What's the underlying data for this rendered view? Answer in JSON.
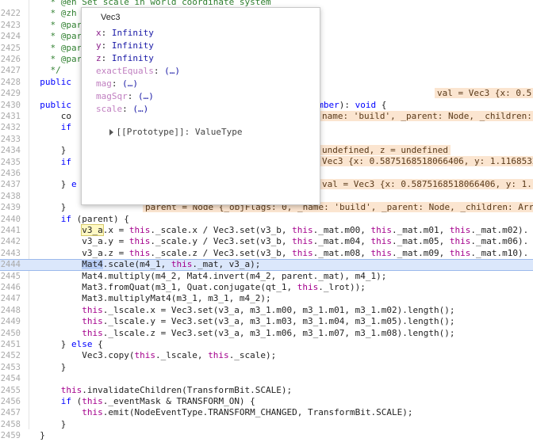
{
  "lines": [
    {
      "n": "",
      "html": "    <span class=\"cm\">* @en Set scale in world coordinate system</span>"
    },
    {
      "n": "2422",
      "html": "    <span class=\"cm\">* @zh</span>"
    },
    {
      "n": "2423",
      "html": "    <span class=\"cm\">* @par</span>"
    },
    {
      "n": "2424",
      "html": "    <span class=\"cm\">* @par</span>"
    },
    {
      "n": "2425",
      "html": "    <span class=\"cm\">* @par</span>"
    },
    {
      "n": "2426",
      "html": "    <span class=\"cm\">* @par</span>"
    },
    {
      "n": "2427",
      "html": "    <span class=\"cm\">*/</span>"
    },
    {
      "n": "2428",
      "html": "  <span class=\"kw\">public</span>                                       ): <span class=\"kw\">void</span>;"
    },
    {
      "n": "2429",
      "html": ""
    },
    {
      "n": "2430",
      "html": "  <span class=\"kw\">public</span>                                       , z?: <span class=\"kw\">number</span>): <span class=\"kw\">void</span> {"
    },
    {
      "n": "2431",
      "html": "      co"
    },
    {
      "n": "2432",
      "html": "      <span class=\"kw\">if</span>"
    },
    {
      "n": "2433",
      "html": ""
    },
    {
      "n": "2434",
      "html": "      }"
    },
    {
      "n": "2435",
      "html": "      <span class=\"kw\">if</span>"
    },
    {
      "n": "2436",
      "html": ""
    },
    {
      "n": "2437",
      "html": "      } <span class=\"kw\">e</span>"
    },
    {
      "n": "2438",
      "html": ""
    },
    {
      "n": "2439",
      "html": "      }"
    },
    {
      "n": "2440",
      "html": "      <span class=\"kw\">if</span> (parent) {"
    },
    {
      "n": "2441",
      "html": "          <span class=\"hl\">v3_a</span>.x = <span class=\"th\">this</span>._scale.x / Vec3.set(v3_b, <span class=\"th\">this</span>._mat.m00, <span class=\"th\">this</span>._mat.m01, <span class=\"th\">this</span>._mat.m02)."
    },
    {
      "n": "2442",
      "html": "          v3_a.y = <span class=\"th\">this</span>._scale.y / Vec3.set(v3_b, <span class=\"th\">this</span>._mat.m04, <span class=\"th\">this</span>._mat.m05, <span class=\"th\">this</span>._mat.m06)."
    },
    {
      "n": "2443",
      "html": "          v3_a.z = <span class=\"th\">this</span>._scale.z / Vec3.set(v3_b, <span class=\"th\">this</span>._mat.m08, <span class=\"th\">this</span>._mat.m09, <span class=\"th\">this</span>._mat.m10)."
    },
    {
      "n": "2444",
      "html": "          <span class=\"sel\">Mat4</span>.scale(m4_1, <span class=\"th\">this</span>._mat, v3_a);",
      "current": true
    },
    {
      "n": "2445",
      "html": "          Mat4.multiply(m4_2, Mat4.invert(m4_2, parent._mat), m4_1);"
    },
    {
      "n": "2446",
      "html": "          Mat3.fromQuat(m3_1, Quat.conjugate(qt_1, <span class=\"th\">this</span>._lrot));"
    },
    {
      "n": "2447",
      "html": "          Mat3.multiplyMat4(m3_1, m3_1, m4_2);"
    },
    {
      "n": "2448",
      "html": "          <span class=\"th\">this</span>._lscale.x = Vec3.set(v3_a, m3_1.m00, m3_1.m01, m3_1.m02).length();"
    },
    {
      "n": "2449",
      "html": "          <span class=\"th\">this</span>._lscale.y = Vec3.set(v3_a, m3_1.m03, m3_1.m04, m3_1.m05).length();"
    },
    {
      "n": "2450",
      "html": "          <span class=\"th\">this</span>._lscale.z = Vec3.set(v3_a, m3_1.m06, m3_1.m07, m3_1.m08).length();"
    },
    {
      "n": "2451",
      "html": "      } <span class=\"kw\">else</span> {"
    },
    {
      "n": "2452",
      "html": "          Vec3.copy(<span class=\"th\">this</span>._lscale, <span class=\"th\">this</span>._scale);"
    },
    {
      "n": "2453",
      "html": "      }"
    },
    {
      "n": "2454",
      "html": ""
    },
    {
      "n": "2455",
      "html": "      <span class=\"th\">this</span>.invalidateChildren(TransformBit.SCALE);"
    },
    {
      "n": "2456",
      "html": "      <span class=\"kw\">if</span> (<span class=\"th\">this</span>._eventMask &amp; TRANSFORM_ON) {"
    },
    {
      "n": "2457",
      "html": "          <span class=\"th\">this</span>.emit(NodeEventType.TRANSFORM_CHANGED, TransformBit.SCALE);"
    },
    {
      "n": "2458",
      "html": "      }"
    },
    {
      "n": "2459",
      "html": "  }"
    }
  ],
  "inline_values": {
    "v2430": "val = Vec3 {x: 0.5",
    "v2432": "name: 'build', _parent: Node, _children: Arr",
    "v2435": "undefined, z = undefined",
    "v2436": "Vec3 {x: 0.5875168518066406, y: 1.1168532",
    "v2438": "val = Vec3 {x: 0.5875168518066406, y: 1.1",
    "v2440": "parent = Node {_objFlags: 0, _name: 'build', _parent: Node, _children: Arr"
  },
  "popover": {
    "title": "Vec3",
    "props": [
      {
        "key": "x",
        "val": "Infinity",
        "faded": false
      },
      {
        "key": "y",
        "val": "Infinity",
        "faded": false
      },
      {
        "key": "z",
        "val": "Infinity",
        "faded": false
      },
      {
        "key": "exactEquals",
        "val": "(…)",
        "faded": true
      },
      {
        "key": "mag",
        "val": "(…)",
        "faded": true
      },
      {
        "key": "magSqr",
        "val": "(…)",
        "faded": true
      },
      {
        "key": "scale",
        "val": "(…)",
        "faded": true
      }
    ],
    "proto_key": "[[Prototype]]",
    "proto_val": "ValueType"
  }
}
